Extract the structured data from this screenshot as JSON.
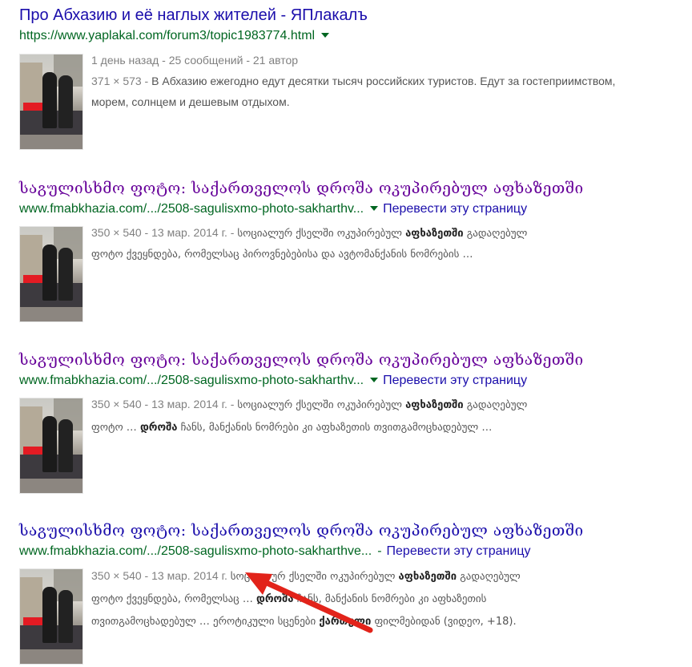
{
  "results": [
    {
      "title": "Про Абхазию и её наглых жителей - ЯПлакалъ",
      "url": "https://www.yaplakal.com/forum3/topic1983774.html",
      "meta": "1 день назад - 25 сообщений - 21 автор",
      "size_date": "371 × 573 - ",
      "snippet": "В Абхазию ежегодно едут десятки тысяч российских туристов. Едут за гостеприимством, морем, солнцем и дешевым отдыхом."
    },
    {
      "title": "საგულისხმო ფოტო: საქართველოს დროშა ოკუპირებულ აფხაზეთში",
      "url": "www.fmabkhazia.com/.../2508-sagulisxmo-photo-sakharthv...",
      "translate": "Перевести эту страницу",
      "size_date": "350 × 540 - 13 мар. 2014 г. - ",
      "s1": "სოციალურ ქსელში ოკუპირებულ ",
      "s1b": "აფხაზეთში",
      "s1c": " გადაღებულ",
      "s2": "ფოტო ქვეყნდება, რომელსაც პიროვნებებისა და ავტომანქანის ნომრების …"
    },
    {
      "title": "საგულისხმო ფოტო: საქართველოს დროშა ოკუპირებულ აფხაზეთში",
      "url": "www.fmabkhazia.com/.../2508-sagulisxmo-photo-sakharthv...",
      "translate": "Перевести эту страницу",
      "size_date": "350 × 540 - 13 мар. 2014 г. - ",
      "s1": "სოციალურ ქსელში ოკუპირებულ ",
      "s1b": "აფხაზეთში",
      "s1c": " გადაღებულ",
      "s2a": "ფოტო … ",
      "s2b": "დროშა",
      "s2c": " ჩანს, მანქანის ნომრები კი აფხაზეთის თვითგამოცხადებულ …"
    },
    {
      "title": "საგულისხმო ფოტო: საქართველოს დროშა ოკუპირებულ აფხაზეთში",
      "url": "www.fmabkhazia.com/.../2508-sagulisxmo-photo-sakharthve...",
      "separator": "-",
      "translate": "Перевести эту страницу",
      "size_date": "350 × 540 - 13 мар. 2014 г. ",
      "s1": "სოციალურ ქსელში ოკუპირებულ ",
      "s1b": "აფხაზეთში",
      "s1c": " გადაღებულ",
      "s2a": "ფოტო ქვეყნდება, რომელსაც … ",
      "s2b": "დროშა",
      "s2c": " ჩანს, მანქანის ნომრები კი აფხაზეთის",
      "s3a": "თვითგამოცხადებულ … ეროტიკული სცენები ",
      "s3b": "ქართული",
      "s3c": " ფილმებიდან (ვიდეო, +18)."
    }
  ],
  "colors": {
    "title_link": "#1a0dab",
    "visited": "#660099",
    "url": "#006621",
    "arrow": "#e2231a"
  }
}
